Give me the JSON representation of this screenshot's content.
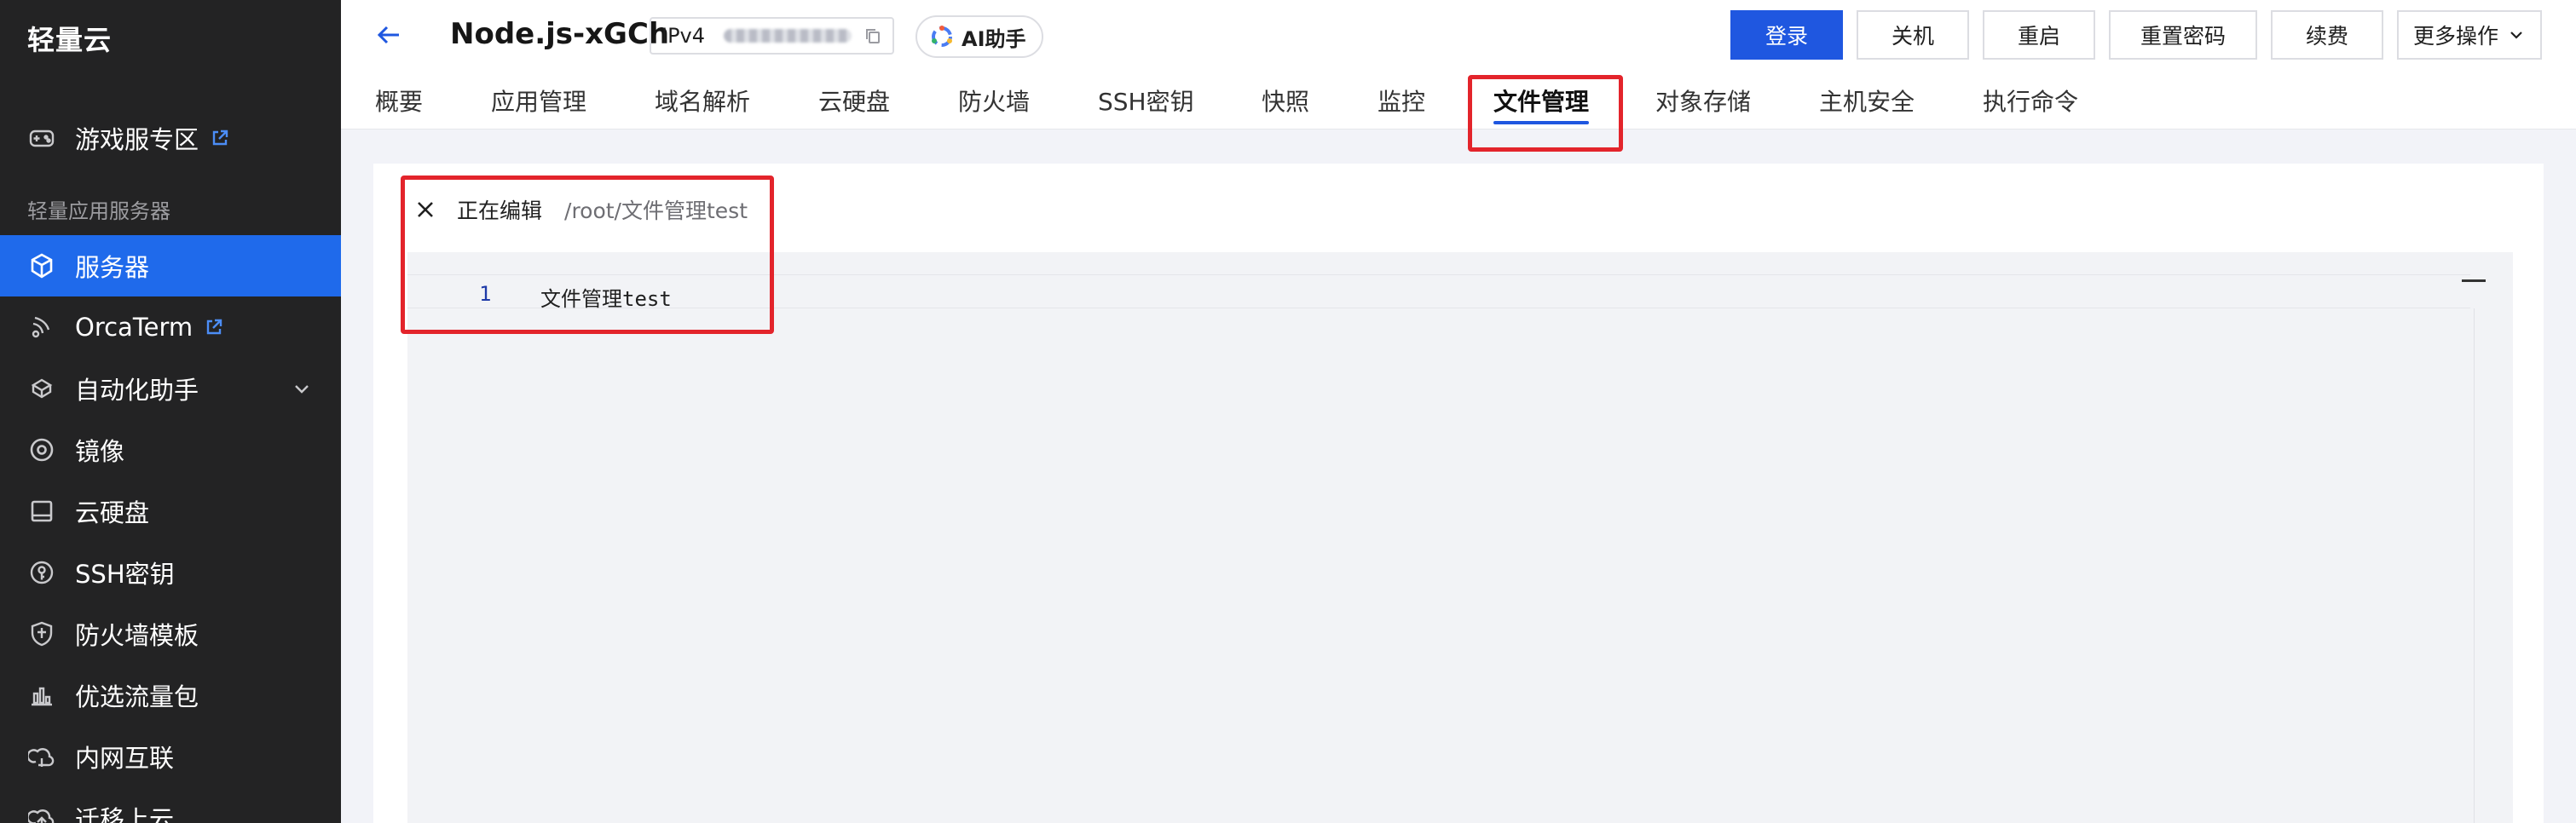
{
  "brand": "轻量云",
  "sidebar": {
    "top_items": [
      {
        "label": "游戏服专区",
        "icon": "gamepad-icon",
        "external": true
      }
    ],
    "section_label": "轻量应用服务器",
    "items": [
      {
        "label": "服务器",
        "icon": "server-cube-icon",
        "active": true
      },
      {
        "label": "OrcaTerm",
        "icon": "terminal-icon",
        "external": true
      },
      {
        "label": "自动化助手",
        "icon": "automation-icon",
        "has_children": true
      },
      {
        "label": "镜像",
        "icon": "image-disc-icon"
      },
      {
        "label": "云硬盘",
        "icon": "disk-icon"
      },
      {
        "label": "SSH密钥",
        "icon": "ssh-key-icon"
      },
      {
        "label": "防火墙模板",
        "icon": "firewall-shield-icon"
      },
      {
        "label": "优选流量包",
        "icon": "traffic-chart-icon"
      },
      {
        "label": "内网互联",
        "icon": "network-icon"
      },
      {
        "label": "迁移上云",
        "icon": "migrate-icon"
      }
    ]
  },
  "header": {
    "server_name": "Node.js-xGCh",
    "ip_label": "IPv4",
    "ai_label": "AI助手",
    "actions": [
      "登录",
      "关机",
      "重启",
      "重置密码",
      "续费"
    ],
    "more_label": "更多操作"
  },
  "tabs": [
    {
      "label": "概要"
    },
    {
      "label": "应用管理"
    },
    {
      "label": "域名解析"
    },
    {
      "label": "云硬盘"
    },
    {
      "label": "防火墙"
    },
    {
      "label": "SSH密钥"
    },
    {
      "label": "快照"
    },
    {
      "label": "监控"
    },
    {
      "label": "文件管理",
      "active": true
    },
    {
      "label": "对象存储"
    },
    {
      "label": "主机安全"
    },
    {
      "label": "执行命令"
    }
  ],
  "editor": {
    "status_label": "正在编辑",
    "file_path": "/root/文件管理test",
    "lines": [
      {
        "number": "1",
        "text": "文件管理test"
      }
    ]
  },
  "colors": {
    "primary": "#1f57e0",
    "sidebar_bg": "#232324",
    "sidebar_active": "#1f6aeb",
    "highlight": "#e3242b"
  }
}
